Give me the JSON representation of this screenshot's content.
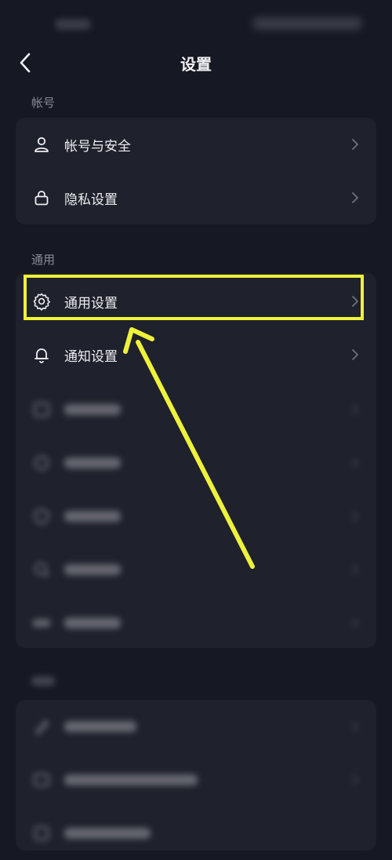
{
  "header": {
    "title": "设置"
  },
  "sections": {
    "account": {
      "label": "帐号",
      "items": [
        {
          "label": "帐号与安全",
          "icon": "person-icon"
        },
        {
          "label": "隐私设置",
          "icon": "lock-icon"
        }
      ]
    },
    "general": {
      "label": "通用",
      "items": [
        {
          "label": "通用设置",
          "icon": "gear-icon"
        },
        {
          "label": "通知设置",
          "icon": "bell-icon"
        }
      ]
    }
  },
  "annotation": {
    "color": "#eef23a",
    "target": "通用设置"
  },
  "colors": {
    "background": "#161823",
    "card": "#1f212c",
    "text": "#eeeef2",
    "secondary": "#8a8b94"
  }
}
